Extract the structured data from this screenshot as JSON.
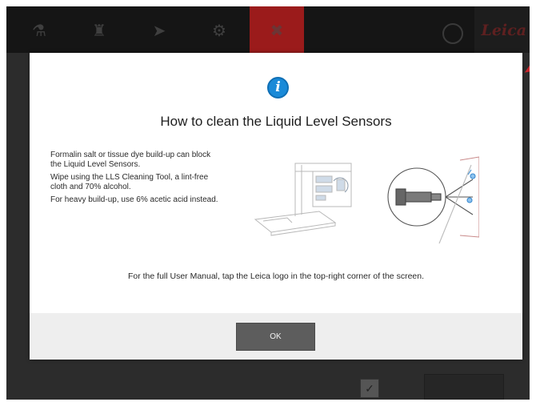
{
  "header": {
    "tabs": [
      {
        "label": "",
        "icon": "flask-icon"
      },
      {
        "label": "",
        "icon": "bottle-icon"
      },
      {
        "label": "",
        "icon": "arrow-icon"
      },
      {
        "label": "",
        "icon": "gear-icon"
      },
      {
        "label": "",
        "icon": "tools-icon",
        "active": true
      }
    ],
    "brand": "Leica"
  },
  "dialog": {
    "title": "How to clean the Liquid Level Sensors",
    "instructions": [
      "Formalin salt or tissue dye build-up can block the Liquid Level Sensors.",
      "Wipe using the LLS Cleaning Tool, a lint-free cloth and 70% alcohol.",
      "For heavy build-up, use 6% acetic acid instead."
    ],
    "manual_note": "For the full User Manual, tap the Leica logo in the top-right corner of the screen.",
    "ok_label": "OK"
  },
  "colors": {
    "accent_red": "#9b1b1b",
    "info_blue": "#1a8ad8",
    "ok_button": "#5d5d5d"
  }
}
